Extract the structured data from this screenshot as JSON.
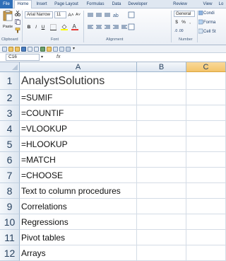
{
  "ribbon_tabs": [
    {
      "label": "File"
    },
    {
      "label": "Home"
    },
    {
      "label": "Insert"
    },
    {
      "label": "Page Layout"
    },
    {
      "label": "Formulas"
    },
    {
      "label": "Data"
    },
    {
      "label": "Developer"
    },
    {
      "label": "Review"
    },
    {
      "label": "View"
    },
    {
      "label": "Lo"
    }
  ],
  "clipboard": {
    "paste_label": "Paste",
    "group_label": "Clipboard"
  },
  "font": {
    "name": "Arial Narrow",
    "size": "11",
    "grow": "A˄",
    "shrink": "A˅",
    "bold": "B",
    "italic": "I",
    "underline": "U",
    "group_label": "Font"
  },
  "alignment": {
    "group_label": "Alignment"
  },
  "number": {
    "format": "General",
    "currency": "$",
    "percent": "%",
    "comma": ",",
    "group_label": "Number"
  },
  "styles": {
    "conditional": "Condi",
    "format_as": "Forma",
    "cell_styles": "Cell St"
  },
  "formula_bar": {
    "name_box": "C16",
    "fx": "fx",
    "formula": ""
  },
  "columns": [
    "A",
    "B",
    "C"
  ],
  "rows": [
    {
      "num": "1",
      "a": "AnalystSolutions"
    },
    {
      "num": "2",
      "a": "=SUMIF"
    },
    {
      "num": "3",
      "a": "=COUNTIF"
    },
    {
      "num": "4",
      "a": "=VLOOKUP"
    },
    {
      "num": "5",
      "a": "=HLOOKUP"
    },
    {
      "num": "6",
      "a": "=MATCH"
    },
    {
      "num": "7",
      "a": "=CHOOSE"
    },
    {
      "num": "8",
      "a": "Text to column procedures"
    },
    {
      "num": "9",
      "a": "Correlations"
    },
    {
      "num": "10",
      "a": "Regressions"
    },
    {
      "num": "11",
      "a": "Pivot tables"
    },
    {
      "num": "12",
      "a": "Arrays"
    }
  ],
  "colors": {
    "accent": "#2f6fb8",
    "selected_header": "#f3c46a"
  }
}
